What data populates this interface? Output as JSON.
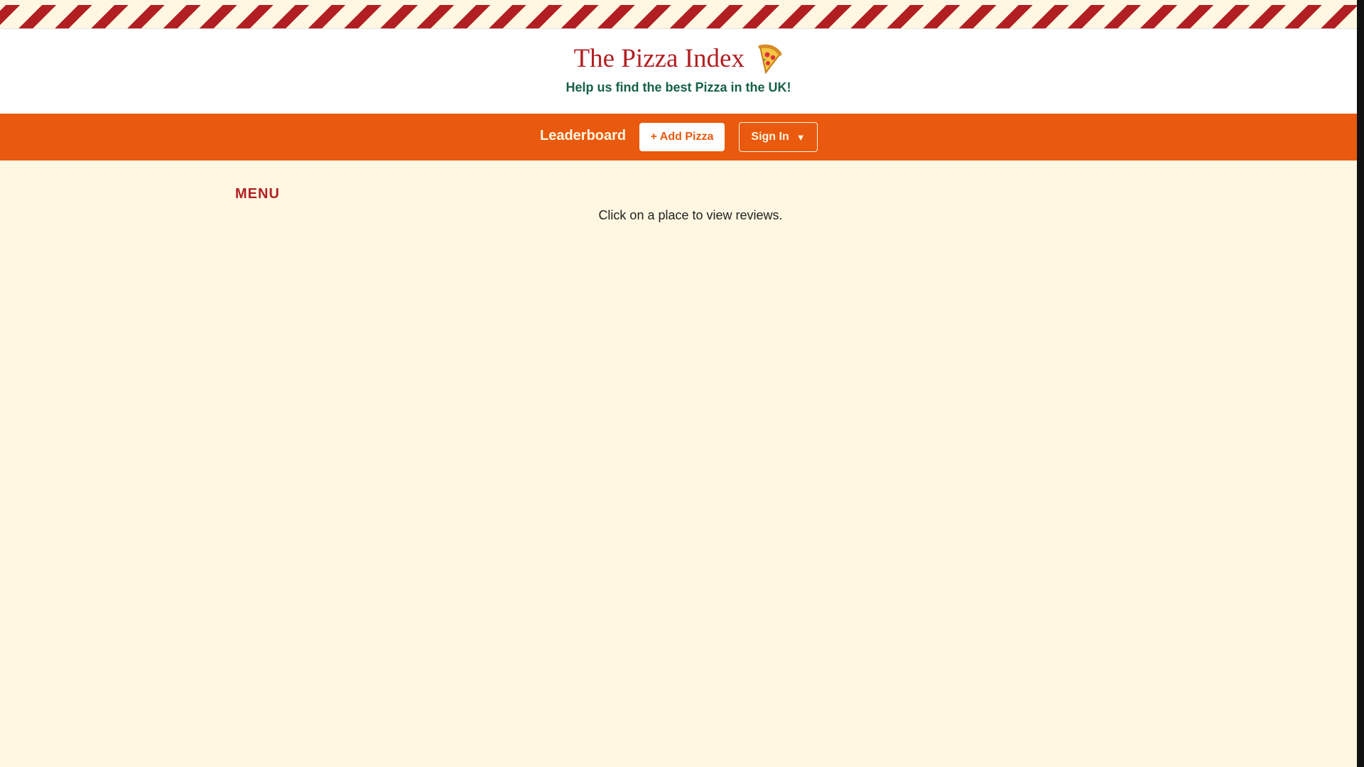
{
  "header": {
    "title": "The Pizza Index",
    "tagline": "Help us find the best Pizza in the UK!",
    "logo_icon": "pizza-slice-icon"
  },
  "nav": {
    "leaderboard_label": "Leaderboard",
    "add_pizza_label": "+ Add Pizza",
    "sign_in_label": "Sign In",
    "sign_in_caret": "▼"
  },
  "main": {
    "menu_heading": "MENU",
    "hint_text": "Click on a place to view reviews."
  },
  "colors": {
    "brand_red": "#b21f23",
    "nav_orange": "#e9590e",
    "cream_background": "#fff7e1",
    "tagline_green": "#16604a"
  }
}
